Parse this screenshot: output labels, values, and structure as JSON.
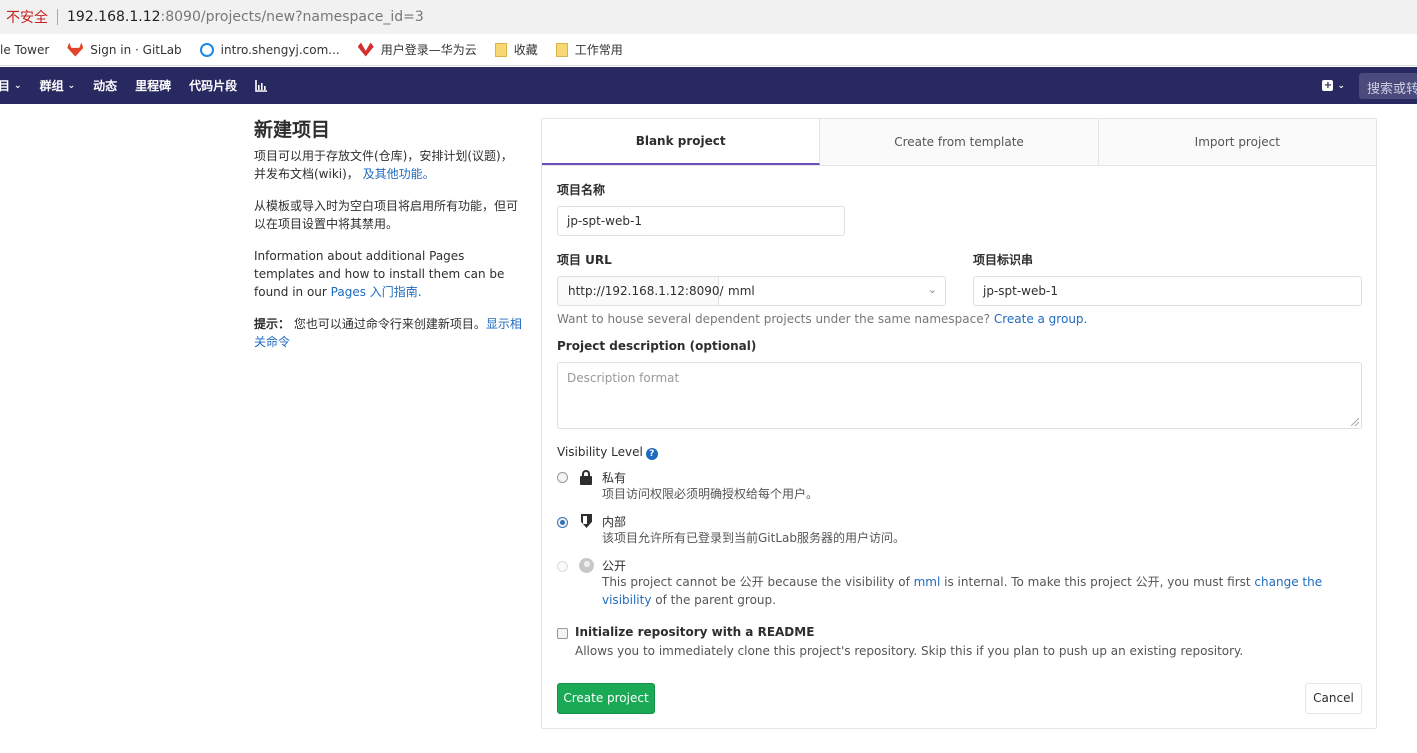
{
  "browser": {
    "insecure_label": "不安全",
    "url_host": "192.168.1.12",
    "url_rest": ":8090/projects/new?namespace_id=3"
  },
  "bookmarks": [
    {
      "label": "le Tower",
      "icon": "none"
    },
    {
      "label": "Sign in · GitLab",
      "icon": "gitlab-icon"
    },
    {
      "label": "intro.shengyj.com...",
      "icon": "s-icon"
    },
    {
      "label": "用户登录—华为云",
      "icon": "huawei-icon"
    },
    {
      "label": "收藏",
      "icon": "folder-icon"
    },
    {
      "label": "工作常用",
      "icon": "folder-icon"
    }
  ],
  "nav": {
    "projects_label": "目",
    "groups_label": "群组",
    "activity_label": "动态",
    "milestones_label": "里程碑",
    "snippets_label": "代码片段",
    "search_placeholder": "搜索或转"
  },
  "info": {
    "title": "新建项目",
    "intro": "项目可以用于存放文件(仓库)，安排计划(议题)，并发布文档(wiki)，",
    "intro_link": "及其他功能。",
    "template_note": "从模板或导入时为空白项目将启用所有功能，但可以在项目设置中将其禁用。",
    "pages_note": "Information about additional Pages templates and how to install them can be found in our ",
    "pages_link": "Pages 入门指南.",
    "tip_label": "提示：",
    "tip_text": "您也可以通过命令行来创建新项目。",
    "tip_link": "显示相关命令"
  },
  "tabs": [
    "Blank project",
    "Create from template",
    "Import project"
  ],
  "form": {
    "name_label": "项目名称",
    "name_value": "jp-spt-web-1",
    "url_label": "项目 URL",
    "url_prefix": "http://192.168.1.12:8090/",
    "namespace_value": "mml",
    "slug_label": "项目标识串",
    "slug_value": "jp-spt-web-1",
    "group_help": "Want to house several dependent projects under the same namespace? ",
    "group_help_link": "Create a group.",
    "desc_label": "Project description (optional)",
    "desc_placeholder": "Description format",
    "visibility_label": "Visibility Level",
    "visibility": {
      "private_title": "私有",
      "private_desc": "项目访问权限必须明确授权给每个用户。",
      "internal_title": "内部",
      "internal_desc": "该项目允许所有已登录到当前GitLab服务器的用户访问。",
      "public_title": "公开",
      "public_desc_1": "This project cannot be 公开 because the visibility of ",
      "public_desc_ns": "mml",
      "public_desc_2": " is internal. To make this project 公开, you must first ",
      "public_desc_link": "change the visibility",
      "public_desc_3": " of the parent group."
    },
    "readme_label": "Initialize repository with a README",
    "readme_desc": "Allows you to immediately clone this project's repository. Skip this if you plan to push up an existing repository.",
    "create_button": "Create project",
    "cancel_button": "Cancel"
  }
}
